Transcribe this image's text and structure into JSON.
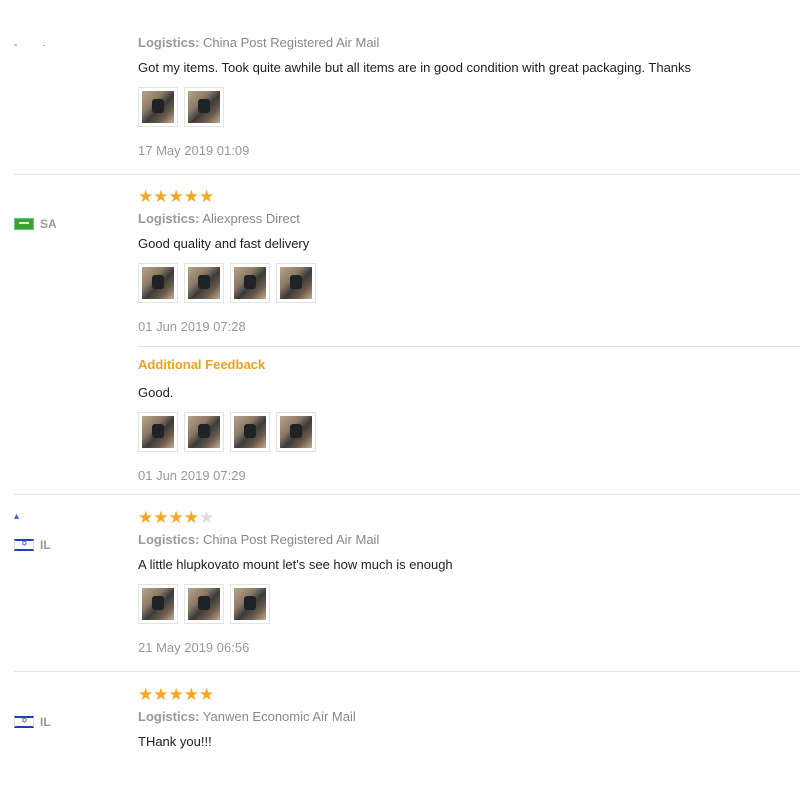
{
  "reviews": [
    {
      "country": "",
      "flag": "",
      "stars": null,
      "logistics_label": "Logistics:",
      "logistics": "China Post Registered Air Mail",
      "text": "Got my items. Took quite awhile but all items are in good condition with great packaging. Thanks",
      "images": 2,
      "date": "17 May 2019 01:09"
    },
    {
      "country": "SA",
      "flag": "sa",
      "stars": 5,
      "logistics_label": "Logistics:",
      "logistics": "Aliexpress Direct",
      "text": "Good quality and fast delivery",
      "images": 4,
      "date": "01 Jun 2019 07:28",
      "additional": {
        "heading": "Additional Feedback",
        "text": "Good.",
        "images": 4,
        "date": "01 Jun 2019 07:29"
      }
    },
    {
      "country": "IL",
      "flag": "il",
      "stars": 4,
      "logistics_label": "Logistics:",
      "logistics": "China Post Registered Air Mail",
      "text": "A little hlupkovato mount let's see how much is enough",
      "images": 3,
      "date": "21 May 2019 06:56"
    },
    {
      "country": "IL",
      "flag": "il",
      "stars": 5,
      "logistics_label": "Logistics:",
      "logistics": "Yanwen Economic Air Mail",
      "text": "THank you!!!",
      "images": 0,
      "date": ""
    }
  ],
  "colors": {
    "star": "#f5a623",
    "star_empty": "#dddddd",
    "additional": "#f0a020"
  }
}
